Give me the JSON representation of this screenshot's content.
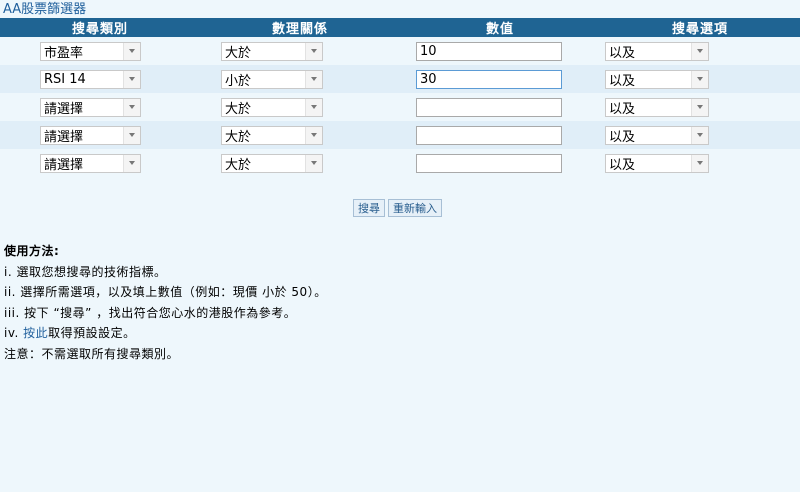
{
  "page": {
    "title": "AA股票篩選器"
  },
  "table": {
    "headers": [
      "搜尋類別",
      "數理關係",
      "數值",
      "搜尋選項"
    ],
    "rows": [
      {
        "category": "市盈率",
        "relation": "大於",
        "value": "10",
        "option": "以及"
      },
      {
        "category": "RSI 14",
        "relation": "小於",
        "value": "30",
        "option": "以及"
      },
      {
        "category": "請選擇",
        "relation": "大於",
        "value": "",
        "option": "以及"
      },
      {
        "category": "請選擇",
        "relation": "大於",
        "value": "",
        "option": "以及"
      },
      {
        "category": "請選擇",
        "relation": "大於",
        "value": "",
        "option": "以及"
      }
    ]
  },
  "buttons": {
    "search": "搜尋",
    "reset": "重新輸入"
  },
  "help": {
    "heading": "使用方法:",
    "step1": "i. 選取您想搜尋的技術指標。",
    "step2": "ii. 選擇所需選項，以及填上數值（例如：現價 小於 50）。",
    "step3": "iii. 按下 “搜尋” ，找出符合您心水的港股作為參考。",
    "step4_prefix": "iv. ",
    "step4_link": "按此",
    "step4_suffix": "取得預設設定。",
    "note": "注意：不需選取所有搜尋類別。"
  }
}
